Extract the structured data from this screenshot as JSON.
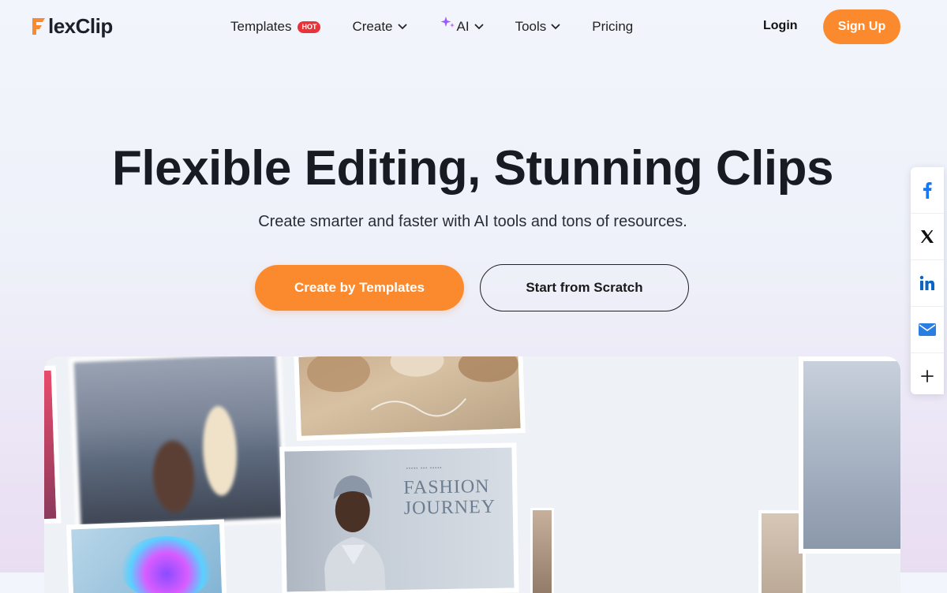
{
  "brand": {
    "name_part1": "F",
    "name_part2": "lexClip",
    "color": "#fb8a2e"
  },
  "nav": {
    "templates": "Templates",
    "hot_badge": "HOT",
    "create": "Create",
    "ai": "AI",
    "tools": "Tools",
    "pricing": "Pricing"
  },
  "auth": {
    "login": "Login",
    "signup": "Sign Up"
  },
  "hero": {
    "title": "Flexible Editing, Stunning Clips",
    "subtitle": "Create smarter and faster with AI tools and tons of resources.",
    "primary_cta": "Create by Templates",
    "secondary_cta": "Start from Scratch"
  },
  "showcase": {
    "fashion_title_line1": "FASHION",
    "fashion_title_line2": "JOURNEY"
  },
  "share": {
    "items": [
      "facebook-icon",
      "x-icon",
      "linkedin-icon",
      "email-icon",
      "plus-icon"
    ]
  },
  "colors": {
    "accent": "#fb8a2e",
    "hot": "#e8333a",
    "facebook": "#1877f2",
    "linkedin": "#0a66c2",
    "email": "#2a7de1"
  }
}
